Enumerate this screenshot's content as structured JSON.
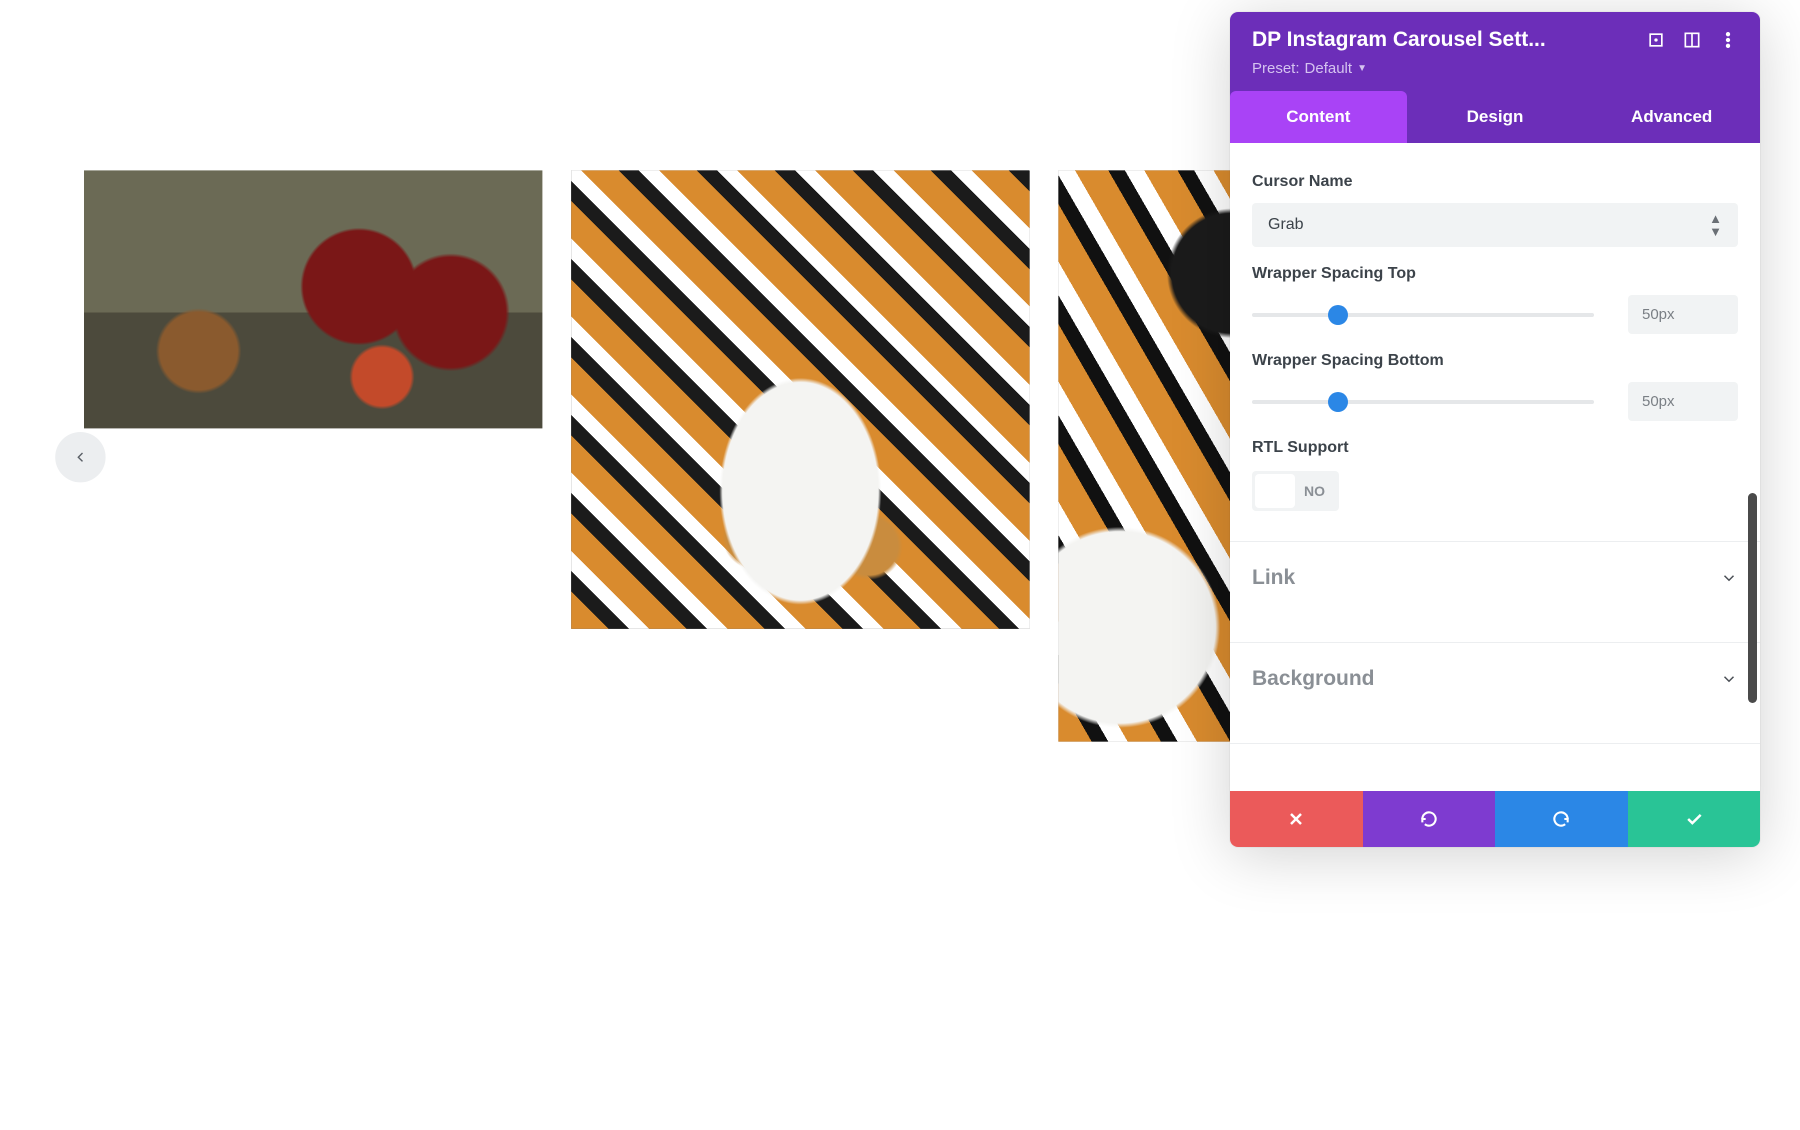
{
  "panel": {
    "title": "DP Instagram Carousel Sett...",
    "preset_label": "Preset:",
    "preset_value": "Default"
  },
  "tabs": {
    "content": "Content",
    "design": "Design",
    "advanced": "Advanced"
  },
  "fields": {
    "cursor_name_label": "Cursor Name",
    "cursor_name_value": "Grab",
    "wrap_top_label": "Wrapper Spacing Top",
    "wrap_top_value": "50px",
    "wrap_bottom_label": "Wrapper Spacing Bottom",
    "wrap_bottom_value": "50px",
    "rtl_label": "RTL Support",
    "rtl_value": "NO"
  },
  "groups": {
    "link": "Link",
    "background": "Background"
  }
}
